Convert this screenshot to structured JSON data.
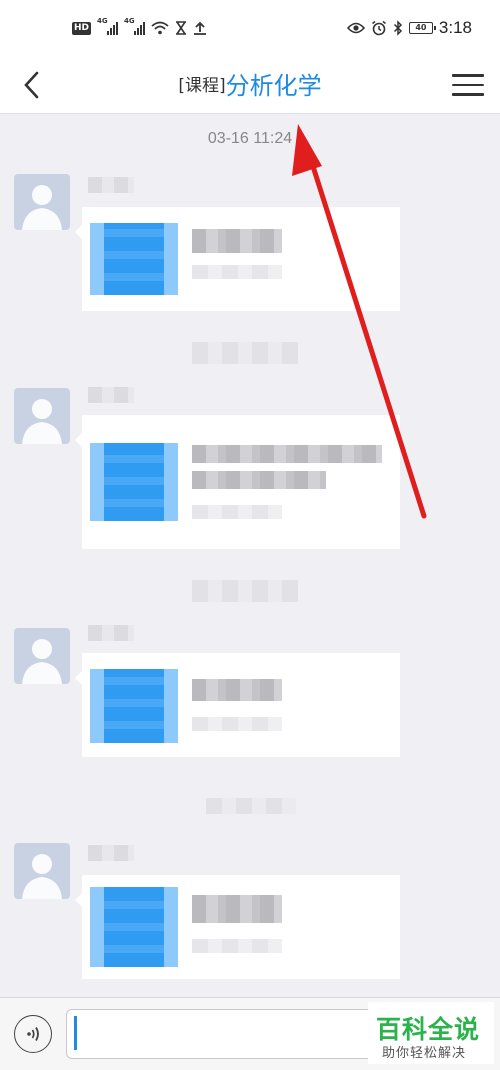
{
  "status_bar": {
    "hd_badge": "HD",
    "network_1": "4G",
    "network_2": "4G",
    "battery_level": "40",
    "time": "3:18",
    "icons": [
      "hd-icon",
      "signal-icon",
      "wifi-icon",
      "hourglass-icon",
      "upload-icon",
      "eye-icon",
      "alarm-icon",
      "bluetooth-icon",
      "battery-icon"
    ]
  },
  "header": {
    "title_prefix": "[课程]",
    "title_name": "分析化学",
    "accent_color": "#1e8ae6"
  },
  "chat": {
    "timestamp": "03-16 11:24"
  },
  "input_bar": {
    "value": "",
    "placeholder": ""
  },
  "watermark": {
    "top": "百科全说",
    "bottom": "助你轻松解决",
    "color": "#29b34a"
  },
  "annotation": {
    "color": "#e01e1e"
  }
}
